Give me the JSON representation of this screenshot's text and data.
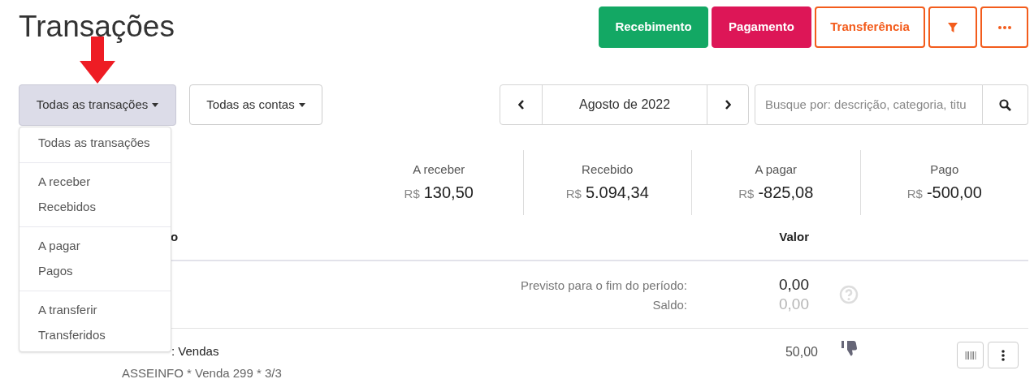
{
  "page_title": "Transações",
  "actions": [
    {
      "label": "Recebimento",
      "kind": "green"
    },
    {
      "label": "Pagamento",
      "kind": "red"
    },
    {
      "label": "Transferência",
      "kind": "outline"
    },
    {
      "kind": "filter"
    },
    {
      "kind": "more"
    }
  ],
  "transaction_filter": {
    "label": "Todas as transações",
    "expanded": true,
    "groups": [
      [
        "Todas as transações"
      ],
      [
        "A receber",
        "Recebidos"
      ],
      [
        "A pagar",
        "Pagos"
      ],
      [
        "A transferir",
        "Transferidos"
      ]
    ]
  },
  "account_filter": {
    "label": "Todas as contas"
  },
  "period": {
    "label": "Agosto de 2022"
  },
  "search": {
    "placeholder": "Busque por: descrição, categoria, titu"
  },
  "summary": [
    {
      "label": "A receber",
      "currency": "R$",
      "amount": "130,50"
    },
    {
      "label": "Recebido",
      "currency": "R$",
      "amount": "5.094,34"
    },
    {
      "label": "A pagar",
      "currency": "R$",
      "amount": "-825,08"
    },
    {
      "label": "Pago",
      "currency": "R$",
      "amount": "-500,00"
    }
  ],
  "table": {
    "columns": [
      "o",
      "Valor"
    ],
    "forecast": {
      "label": "Previsto para o fim do período:",
      "value": "0,00"
    },
    "balance": {
      "label": "Saldo:",
      "value": "0,00"
    },
    "rows": [
      {
        "title": ": Vendas",
        "description": "ASSEINFO * Venda 299 * 3/3",
        "value": "50,00",
        "confirmed": false
      }
    ]
  }
}
